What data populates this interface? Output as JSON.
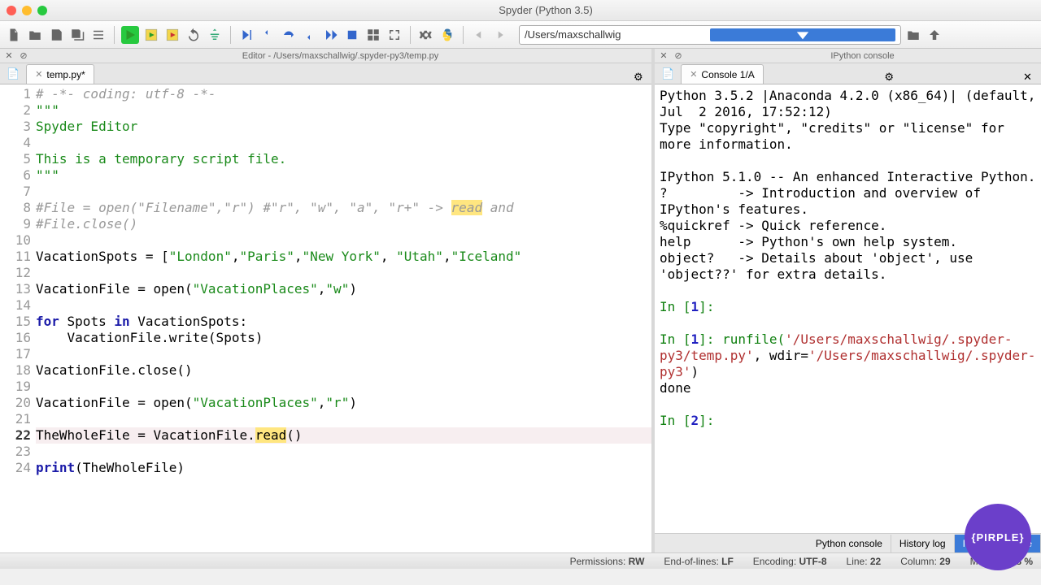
{
  "window": {
    "title": "Spyder (Python 3.5)"
  },
  "path": {
    "value": "/Users/maxschallwig"
  },
  "editor": {
    "header": "Editor - /Users/maxschallwig/.spyder-py3/temp.py",
    "tab": "temp.py*",
    "current_line": 22,
    "lines": [
      {
        "n": 1,
        "raw": "# -*- coding: utf-8 -*-",
        "type": "com"
      },
      {
        "n": 2,
        "raw": "\"\"\"",
        "type": "str"
      },
      {
        "n": 3,
        "raw": "Spyder Editor",
        "type": "str"
      },
      {
        "n": 4,
        "raw": "",
        "type": "str"
      },
      {
        "n": 5,
        "raw": "This is a temporary script file.",
        "type": "str"
      },
      {
        "n": 6,
        "raw": "\"\"\"",
        "type": "str"
      },
      {
        "n": 7,
        "raw": ""
      },
      {
        "n": 8,
        "com_pre": "#File = open(\"Filename\",\"r\") #\"r\", \"w\", \"a\", \"r+\" -> ",
        "hl": "read",
        "com_post": " and"
      },
      {
        "n": 9,
        "raw": "#File.close()",
        "type": "com"
      },
      {
        "n": 10,
        "raw": ""
      },
      {
        "n": 11,
        "parts": [
          [
            "",
            "VacationSpots = ["
          ],
          [
            "str",
            "\"London\""
          ],
          [
            "",
            ","
          ],
          [
            "str",
            "\"Paris\""
          ],
          [
            "",
            ","
          ],
          [
            "str",
            "\"New York\""
          ],
          [
            "",
            ", "
          ],
          [
            "str",
            "\"Utah\""
          ],
          [
            "",
            ","
          ],
          [
            "str",
            "\"Iceland\""
          ]
        ]
      },
      {
        "n": 12,
        "raw": ""
      },
      {
        "n": 13,
        "parts": [
          [
            "",
            "VacationFile = open("
          ],
          [
            "str",
            "\"VacationPlaces\""
          ],
          [
            "",
            ","
          ],
          [
            "str",
            "\"w\""
          ],
          [
            "",
            ")"
          ]
        ]
      },
      {
        "n": 14,
        "raw": ""
      },
      {
        "n": 15,
        "parts": [
          [
            "kw",
            "for"
          ],
          [
            "",
            " Spots "
          ],
          [
            "kw",
            "in"
          ],
          [
            "",
            " VacationSpots:"
          ]
        ]
      },
      {
        "n": 16,
        "raw": "    VacationFile.write(Spots)"
      },
      {
        "n": 17,
        "raw": ""
      },
      {
        "n": 18,
        "raw": "VacationFile.close()"
      },
      {
        "n": 19,
        "raw": ""
      },
      {
        "n": 20,
        "parts": [
          [
            "",
            "VacationFile = open("
          ],
          [
            "str",
            "\"VacationPlaces\""
          ],
          [
            "",
            ","
          ],
          [
            "str",
            "\"r\""
          ],
          [
            "",
            ")"
          ]
        ]
      },
      {
        "n": 21,
        "raw": ""
      },
      {
        "n": 22,
        "parts": [
          [
            "",
            "TheWholeFile = VacationFile."
          ],
          [
            "hl",
            "read"
          ],
          [
            "",
            "()"
          ]
        ]
      },
      {
        "n": 23,
        "raw": ""
      },
      {
        "n": 24,
        "parts": [
          [
            "kw",
            "print"
          ],
          [
            "",
            "(TheWholeFile)"
          ]
        ]
      }
    ]
  },
  "console": {
    "header": "IPython console",
    "tab": "Console 1/A",
    "banner": "Python 3.5.2 |Anaconda 4.2.0 (x86_64)| (default, Jul  2 2016, 17:52:12)\nType \"copyright\", \"credits\" or \"license\" for more information.\n\nIPython 5.1.0 -- An enhanced Interactive Python.\n?         -> Introduction and overview of IPython's features.\n%quickref -> Quick reference.\nhelp      -> Python's own help system.\nobject?   -> Details about 'object', use 'object??' for extra details.",
    "in1_label": "In [",
    "in1_num": "1",
    "in1_post": "]:",
    "run_pre": "In [",
    "run_num": "1",
    "run_post": "]: runfile(",
    "runfile_arg1": "'/Users/maxschallwig/.spyder-py3/temp.py'",
    "runfile_mid": ", wdir=",
    "runfile_arg2": "'/Users/maxschallwig/.spyder-py3'",
    "runfile_end": ")",
    "done": "done",
    "in2_num": "2"
  },
  "btabs": {
    "a": "Python console",
    "b": "History log",
    "c": "IPython console"
  },
  "status": {
    "perm_l": "Permissions: ",
    "perm_v": "RW",
    "eol_l": "End-of-lines: ",
    "eol_v": "LF",
    "enc_l": "Encoding: ",
    "enc_v": "UTF-8",
    "line_l": "Line: ",
    "line_v": "22",
    "col_l": "Column: ",
    "col_v": "29",
    "mem_l": "Memory: ",
    "mem_v": "68 %"
  },
  "badge": "{PIRPLE}"
}
